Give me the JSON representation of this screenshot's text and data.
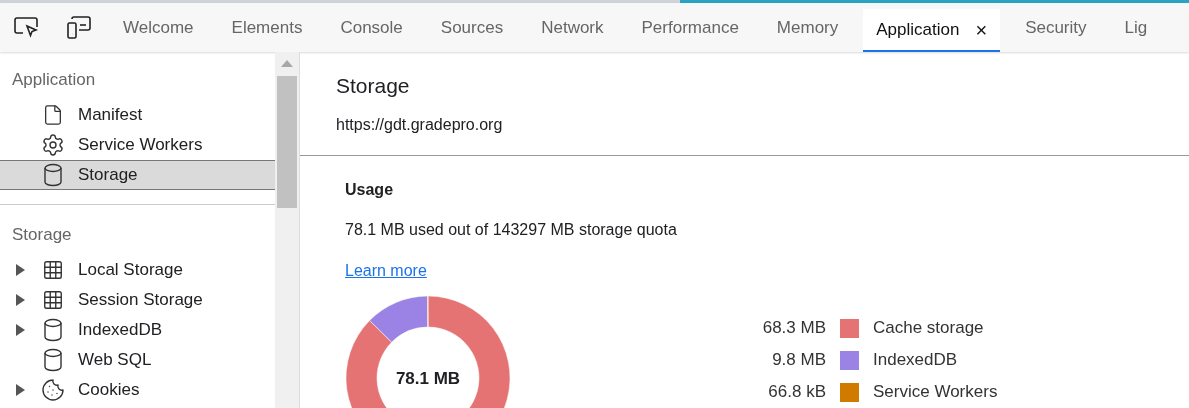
{
  "tabs": [
    {
      "label": "Welcome",
      "selected": false
    },
    {
      "label": "Elements",
      "selected": false
    },
    {
      "label": "Console",
      "selected": false
    },
    {
      "label": "Sources",
      "selected": false
    },
    {
      "label": "Network",
      "selected": false
    },
    {
      "label": "Performance",
      "selected": false
    },
    {
      "label": "Memory",
      "selected": false
    },
    {
      "label": "Application",
      "selected": true,
      "close": "×"
    },
    {
      "label": "Security",
      "selected": false
    },
    {
      "label": "Lig",
      "selected": false
    }
  ],
  "sidebar": {
    "sections": [
      {
        "title": "Application",
        "items": [
          {
            "label": "Manifest",
            "kind": "file",
            "selected": false
          },
          {
            "label": "Service Workers",
            "kind": "gear",
            "selected": false
          },
          {
            "label": "Storage",
            "kind": "database",
            "selected": true
          }
        ]
      },
      {
        "title": "Storage",
        "items": [
          {
            "label": "Local Storage",
            "kind": "grid",
            "expandable": true,
            "selected": false
          },
          {
            "label": "Session Storage",
            "kind": "grid",
            "expandable": true,
            "selected": false
          },
          {
            "label": "IndexedDB",
            "kind": "database",
            "expandable": true,
            "selected": false
          },
          {
            "label": "Web SQL",
            "kind": "database",
            "expandable": false,
            "selected": false
          },
          {
            "label": "Cookies",
            "kind": "cookie",
            "expandable": true,
            "selected": false
          }
        ]
      }
    ]
  },
  "main": {
    "title": "Storage",
    "origin": "https://gdt.gradepro.org",
    "usage": {
      "heading": "Usage",
      "summary": "78.1 MB used out of 143297 MB storage quota",
      "link": "Learn more",
      "total": "78.1 MB",
      "chart_data": {
        "type": "donut",
        "categories": [
          "Cache storage",
          "IndexedDB",
          "Service Workers"
        ],
        "series": [
          {
            "values": [
              87.38,
              12.54,
              0.08
            ]
          }
        ],
        "value_labels": [
          "68.3 MB",
          "9.8 MB",
          "66.8 kB"
        ]
      },
      "legend": [
        {
          "color": "#e57373"
        },
        {
          "color": "#9b82e5"
        },
        {
          "color": "#d07a00"
        }
      ]
    }
  }
}
